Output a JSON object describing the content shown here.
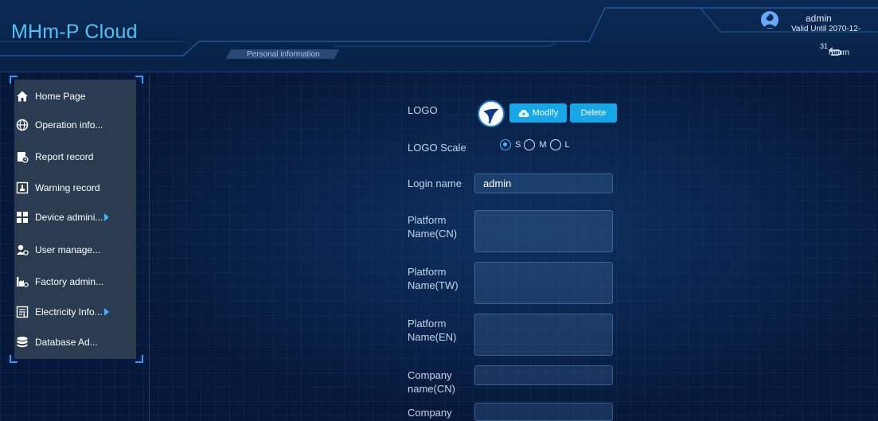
{
  "app": {
    "title": "MHm-P Cloud"
  },
  "header": {
    "active_tab": "Personal information",
    "user": {
      "name": "admin",
      "valid_until": "Valid Until 2070-12-",
      "valid_tail": "31"
    },
    "return_label": "return"
  },
  "sidebar": {
    "items": [
      {
        "label": "Home Page",
        "icon": "home-icon",
        "has_submenu": false
      },
      {
        "label": "Operation info...",
        "icon": "globe-icon",
        "has_submenu": false
      },
      {
        "label": "Report record",
        "icon": "report-icon",
        "has_submenu": false
      },
      {
        "label": "Warning record",
        "icon": "warning-icon",
        "has_submenu": false
      },
      {
        "label": "Device admini...",
        "icon": "device-icon",
        "has_submenu": true
      },
      {
        "label": "User manage...",
        "icon": "user-icon",
        "has_submenu": false
      },
      {
        "label": "Factory admin...",
        "icon": "factory-icon",
        "has_submenu": false
      },
      {
        "label": "Electricity Info...",
        "icon": "electricity-icon",
        "has_submenu": true
      },
      {
        "label": "Database Ad...",
        "icon": "database-icon",
        "has_submenu": false
      }
    ]
  },
  "form": {
    "logo_label": "LOGO",
    "modify_label": "Modify",
    "delete_label": "Delete",
    "logo_scale_label": "LOGO Scale",
    "scale_options": [
      "S",
      "M",
      "L"
    ],
    "scale_selected": "S",
    "login_name_label": "Login name",
    "login_name_value": "admin",
    "platform_cn_label": "Platform Name(CN)",
    "platform_cn_value": "",
    "platform_tw_label": "Platform Name(TW)",
    "platform_tw_value": "",
    "platform_en_label": "Platform Name(EN)",
    "platform_en_value": "",
    "company_cn_label": "Company name(CN)",
    "company_cn_value": "",
    "company_next_label": "Company",
    "company_next_value": ""
  },
  "colors": {
    "accent": "#16a7e8",
    "title": "#4fc3f7",
    "background": "#06183a"
  }
}
